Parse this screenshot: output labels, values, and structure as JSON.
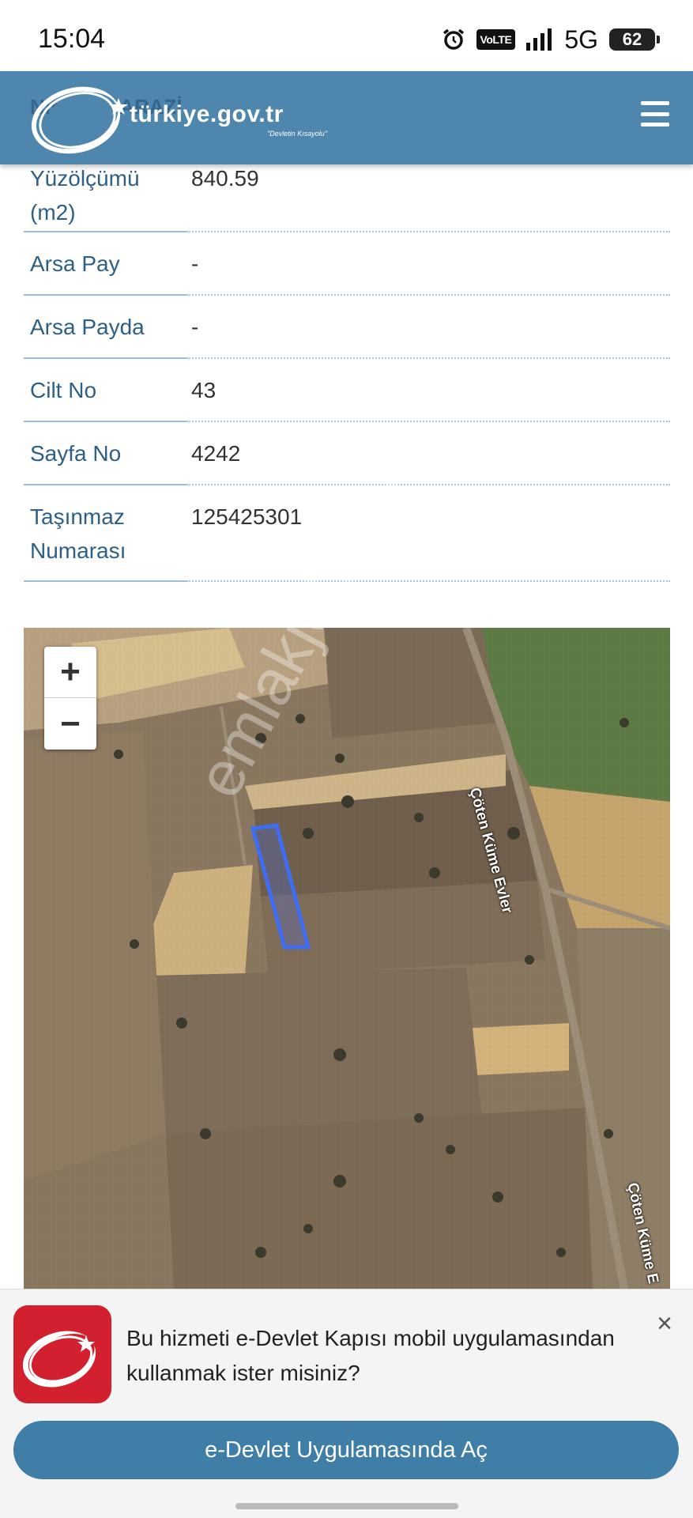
{
  "status": {
    "time": "15:04",
    "volte": "VoLTE",
    "network": "5G",
    "battery": "62"
  },
  "header": {
    "logo_text": "türkiye.gov.tr",
    "logo_subtitle": "\"Devletin Kısayolu\"",
    "ghost_text": "Nitelik ... ARAZİ"
  },
  "details": {
    "rows": [
      {
        "label": "Yüzölçümü (m2)",
        "value": "840.59"
      },
      {
        "label": "Arsa Pay",
        "value": "-"
      },
      {
        "label": "Arsa Payda",
        "value": "-"
      },
      {
        "label": "Cilt No",
        "value": "43"
      },
      {
        "label": "Sayfa No",
        "value": "4242"
      },
      {
        "label": "Taşınmaz Numarası",
        "value": "125425301"
      }
    ]
  },
  "map": {
    "zoom_in": "+",
    "zoom_out": "−",
    "road_label_1": "Çöten Küme Evler",
    "road_label_2": "Çöten Küme E",
    "parcel_color": "#3f6df2",
    "watermark": "emlakjet.com"
  },
  "banner": {
    "message": "Bu hizmeti e-Devlet Kapısı mobil uygulamasından kullanmak ister misiniz?",
    "close": "×",
    "open_button": "e-Devlet Uygulamasında Aç"
  }
}
